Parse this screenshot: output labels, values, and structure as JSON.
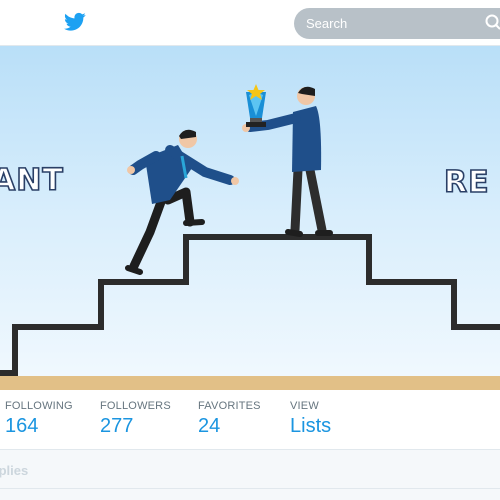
{
  "search": {
    "placeholder": "Search"
  },
  "banner": {
    "left_text": "ANT",
    "right_text": "RE"
  },
  "stats": [
    {
      "label": "FOLLOWING",
      "value": "164"
    },
    {
      "label": "FOLLOWERS",
      "value": "277"
    },
    {
      "label": "FAVORITES",
      "value": "24"
    },
    {
      "label": "VIEW",
      "value": "Lists"
    }
  ],
  "below": {
    "text": "Replies"
  },
  "colors": {
    "brand": "#1da1f2",
    "accent": "#1b95e0",
    "search_bg": "#b8c1c8",
    "banner_sky": "#cfe9fb",
    "ground": "#e2c087"
  },
  "icons": [
    "twitter-bird-icon",
    "search-icon",
    "trophy-icon"
  ]
}
